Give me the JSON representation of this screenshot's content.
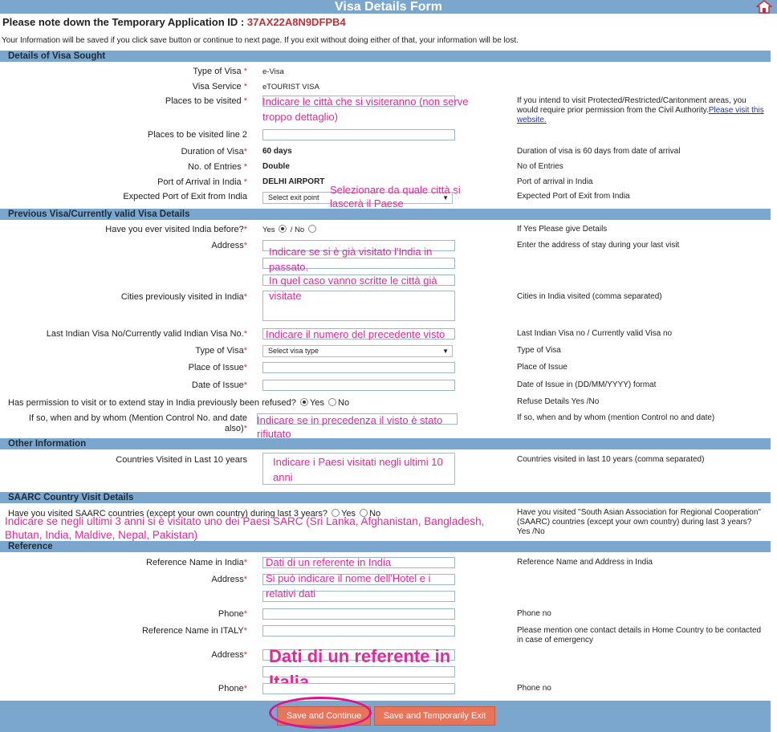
{
  "header": {
    "title": "Visa Details Form",
    "app_id_label": "Please note down the Temporary Application ID :",
    "app_id_value": "37AX22A8N9DFPB4",
    "notice": "Your Information will be saved if you click save button or continue to next page. If you exit without doing either of that, your information will be lost."
  },
  "sections": {
    "visa_sought": "Details of Visa Sought",
    "previous": "Previous Visa/Currently valid Visa Details",
    "other": "Other Information",
    "saarc": "SAARC Country Visit Details",
    "reference": "Reference"
  },
  "visa_sought": {
    "type_label": "Type of Visa",
    "type_value": "e-Visa",
    "service_label": "Visa Service",
    "service_value": "eTOURIST VISA",
    "places_label": "Places to be visited",
    "places_help": "If you intend to visit Protected/Restricted/Cantonment areas, you would require prior permission from the Civil Authority.",
    "places_link": "Please visit this website.",
    "places2_label": "Places to be visited line 2",
    "duration_label": "Duration of Visa",
    "duration_value": "60 days",
    "duration_help": "Duration of visa is 60 days from date of arrival",
    "entries_label": "No. of Entries",
    "entries_value": "Double",
    "entries_help": "No of Entries",
    "arrival_label": "Port of Arrival in India",
    "arrival_value": "DELHI AIRPORT",
    "arrival_help": "Port of arrival in India",
    "exit_label": "Expected Port of Exit from India",
    "exit_select": "Select exit point",
    "exit_help": "Expected Port of Exit from India"
  },
  "previous": {
    "visited_label": "Have you ever visited India before?",
    "yes": "Yes",
    "no": "No",
    "visited_help": "If Yes Please give Details",
    "address_label": "Address",
    "address_help": "Enter the address of stay during your last visit",
    "cities_label": "Cities previously visited in India",
    "cities_help": "Cities in India visited (comma separated)",
    "visa_no_label": "Last Indian Visa No/Currently valid Indian Visa No.",
    "visa_no_help": "Last Indian Visa no / Currently valid Visa no",
    "type_label": "Type of Visa",
    "type_select": "Select visa type",
    "type_help": "Type of Visa",
    "place_issue_label": "Place of Issue",
    "place_issue_help": "Place of Issue",
    "date_issue_label": "Date of Issue",
    "date_issue_help": "Date of Issue in (DD/MM/YYYY) format",
    "refused_label": "Has permission to visit or to extend stay in India previously been refused?",
    "refused_help": "Refuse Details Yes /No",
    "ifso_label": "If so, when and by whom (Mention Control No. and date also)",
    "ifso_help": "If so, when and by whom (mention Control no and date)"
  },
  "other": {
    "countries_label": "Countries Visited in Last 10 years",
    "countries_help": "Countries visited in last 10 years (comma separated)"
  },
  "saarc": {
    "question": "Have you visited SAARC countries (except your own country) during last 3 years?",
    "yes": "Yes",
    "no": "No",
    "help": "Have you visited \"South Asian Association for Regional Cooperation\" (SAARC) countries (except your own country) during last 3 years? Yes /No"
  },
  "reference": {
    "name_india_label": "Reference Name in India",
    "name_india_help": "Reference Name and Address in India",
    "address_label": "Address",
    "phone_label": "Phone",
    "phone_help": "Phone no",
    "name_italy_label": "Reference Name in ITALY",
    "name_italy_help": "Please mention one contact details in Home Country to be contacted in case of emergency",
    "address2_label": "Address",
    "phone2_label": "Phone",
    "phone2_help": "Phone no"
  },
  "buttons": {
    "save_continue": "Save and Continue",
    "save_exit": "Save and Temporarily Exit"
  },
  "annotations": {
    "places": "Indicare le città che si visiteranno (non serve troppo dettaglio)",
    "exit": "Selezionare da quale città si lascerà il Paese",
    "visited": "Indicare se si è già visitato l'India in passato.",
    "cities": "In quel caso vanno scritte le città già visitate",
    "visa_no": "Indicare il numero del precedente visto",
    "refused": "Indicare se in precedenza il visto è stato rifiutato",
    "countries": "Indicare i Paesi visitati negli ultimi 10 anni",
    "saarc": "Indicare se negli ultimi 3 anni si è visitato uno dei Paesi SARC (Sri Lanka, Afghanistan, Bangladesh, Bhutan, India, Maldive, Nepal, Pakistan)",
    "ref_india": "Dati di un referente in India",
    "hotel": "Si può indicare il nome dell'Hotel e i relativi dati",
    "ref_italy": "Dati di un referente in Italia"
  },
  "colors": {
    "header_bar": "#7ba7cf",
    "app_id": "#c0303a",
    "annotation": "#e02a9a",
    "button": "#e8745a"
  }
}
